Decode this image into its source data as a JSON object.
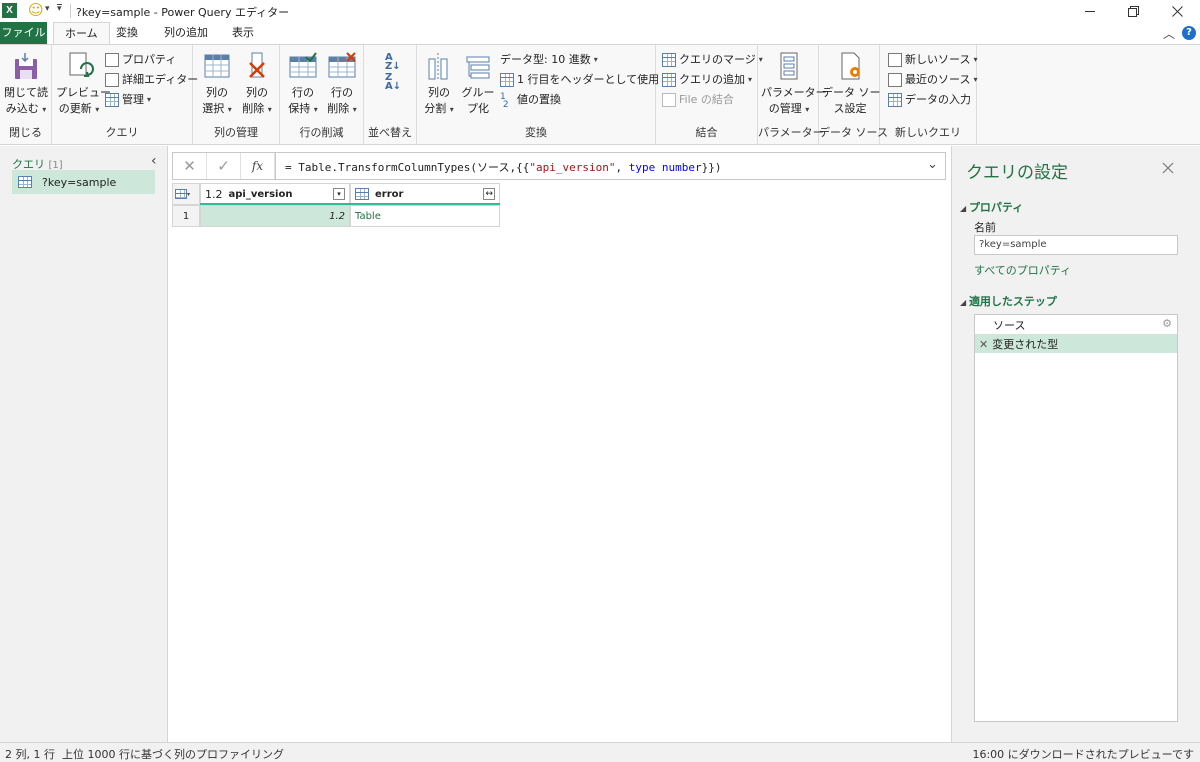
{
  "window": {
    "title": "?key=sample - Power Query エディター",
    "excel_icon_label": "X",
    "qat_smiley": "☺",
    "qat_caret": "▾",
    "qat_customize": "▾"
  },
  "tabs": [
    {
      "label": "ファイル"
    },
    {
      "label": "ホーム"
    },
    {
      "label": "変換"
    },
    {
      "label": "列の追加"
    },
    {
      "label": "表示"
    }
  ],
  "ribbon": {
    "close_group": {
      "btn_line1": "閉じて読",
      "btn_line2": "み込む",
      "label": "閉じる"
    },
    "query_group": {
      "preview_line1": "プレビュー",
      "preview_line2": "の更新",
      "properties": "プロパティ",
      "advanced_editor": "詳細エディター",
      "manage": "管理",
      "label": "クエリ"
    },
    "column_manage": {
      "select_line1": "列の",
      "select_line2": "選択",
      "remove_line1": "列の",
      "remove_line2": "削除",
      "label": "列の管理"
    },
    "row_reduce": {
      "keep_line1": "行の",
      "keep_line2": "保持",
      "remove_line1": "行の",
      "remove_line2": "削除",
      "label": "行の削減"
    },
    "sort": {
      "label": "並べ替え"
    },
    "transform": {
      "split_line1": "列の",
      "split_line2": "分割",
      "group_line1": "グルー",
      "group_line2": "プ化",
      "datatype": "データ型: 10 進数",
      "first_row_header": "1 行目をヘッダーとして使用",
      "replace_values": "値の置換",
      "label": "変換"
    },
    "combine": {
      "merge": "クエリのマージ",
      "append": "クエリの追加",
      "combine_files": "File の結合",
      "label": "結合"
    },
    "params": {
      "btn_line1": "パラメーター",
      "btn_line2": "の管理",
      "label": "パラメーター"
    },
    "datasource": {
      "btn_line1": "データ ソー",
      "btn_line2": "ス設定",
      "label": "データ ソース"
    },
    "newquery": {
      "new_source": "新しいソース",
      "recent_source": "最近のソース",
      "enter_data": "データの入力",
      "label": "新しいクエリ"
    }
  },
  "left_pane": {
    "header": "クエリ",
    "count": "[1]",
    "queries": [
      {
        "name": "?key=sample"
      }
    ]
  },
  "formula_bar": {
    "cancel": "✕",
    "confirm": "✓",
    "fx": "fx",
    "formula_prefix": "= Table.TransformColumnTypes(ソース,{{",
    "formula_string": "\"api_version\"",
    "formula_mid": ", ",
    "formula_keyword": "type number",
    "formula_suffix": "}})"
  },
  "grid": {
    "columns": [
      {
        "type": "1.2",
        "name": "api_version"
      },
      {
        "type": "",
        "name": "error"
      }
    ],
    "rows": [
      {
        "index": "1",
        "cells": [
          "1.2",
          "Table"
        ]
      }
    ]
  },
  "right_pane": {
    "title": "クエリの設定",
    "properties_header": "プロパティ",
    "name_label": "名前",
    "name_value": "?key=sample",
    "all_properties_link": "すべてのプロパティ",
    "steps_header": "適用したステップ",
    "steps": [
      {
        "name": "ソース",
        "has_gear": true
      },
      {
        "name": "変更された型",
        "has_gear": false
      }
    ]
  },
  "status_bar": {
    "counts": "2 列, 1 行",
    "profiling": "上位 1000 行に基づく列のプロファイリング",
    "preview_time": "16:00 にダウンロードされたプレビューです"
  },
  "colors": {
    "accent_green": "#217346",
    "selection_green": "#cde8da",
    "formula_string": "#a31515",
    "formula_keyword": "#0000ff",
    "help_blue": "#1e6fc9"
  }
}
